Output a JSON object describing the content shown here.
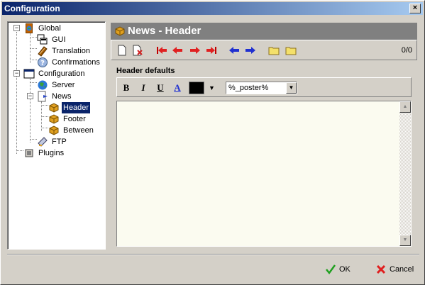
{
  "window": {
    "title": "Configuration",
    "close_label": "×"
  },
  "tree": {
    "items": [
      {
        "label": "Global",
        "icon": "globe-book-icon"
      },
      {
        "label": "GUI",
        "icon": "gui-windows-icon"
      },
      {
        "label": "Translation",
        "icon": "translation-book-icon"
      },
      {
        "label": "Confirmations",
        "icon": "question-icon"
      },
      {
        "label": "Configuration",
        "icon": "window-icon"
      },
      {
        "label": "Server",
        "icon": "globe-icon"
      },
      {
        "label": "News",
        "icon": "news-page-icon"
      },
      {
        "label": "Header",
        "icon": "header-cube-icon"
      },
      {
        "label": "Footer",
        "icon": "footer-cube-icon"
      },
      {
        "label": "Between",
        "icon": "between-cube-icon"
      },
      {
        "label": "FTP",
        "icon": "ftp-icon"
      },
      {
        "label": "Plugins",
        "icon": "plugin-icon"
      }
    ],
    "selected": "Header"
  },
  "panel": {
    "title": "News - Header",
    "counter": "0/0",
    "section_label": "Header defaults",
    "format": {
      "bold": "B",
      "italic": "I",
      "underline": "U",
      "font": "A"
    },
    "color": "#000000",
    "variable_select": "%_poster%"
  },
  "buttons": {
    "ok": "OK",
    "cancel": "Cancel"
  },
  "colors": {
    "title_start": "#0a246a",
    "title_end": "#a6caf0",
    "header_bar": "#808080",
    "editor_bg": "#fbfbf0"
  }
}
